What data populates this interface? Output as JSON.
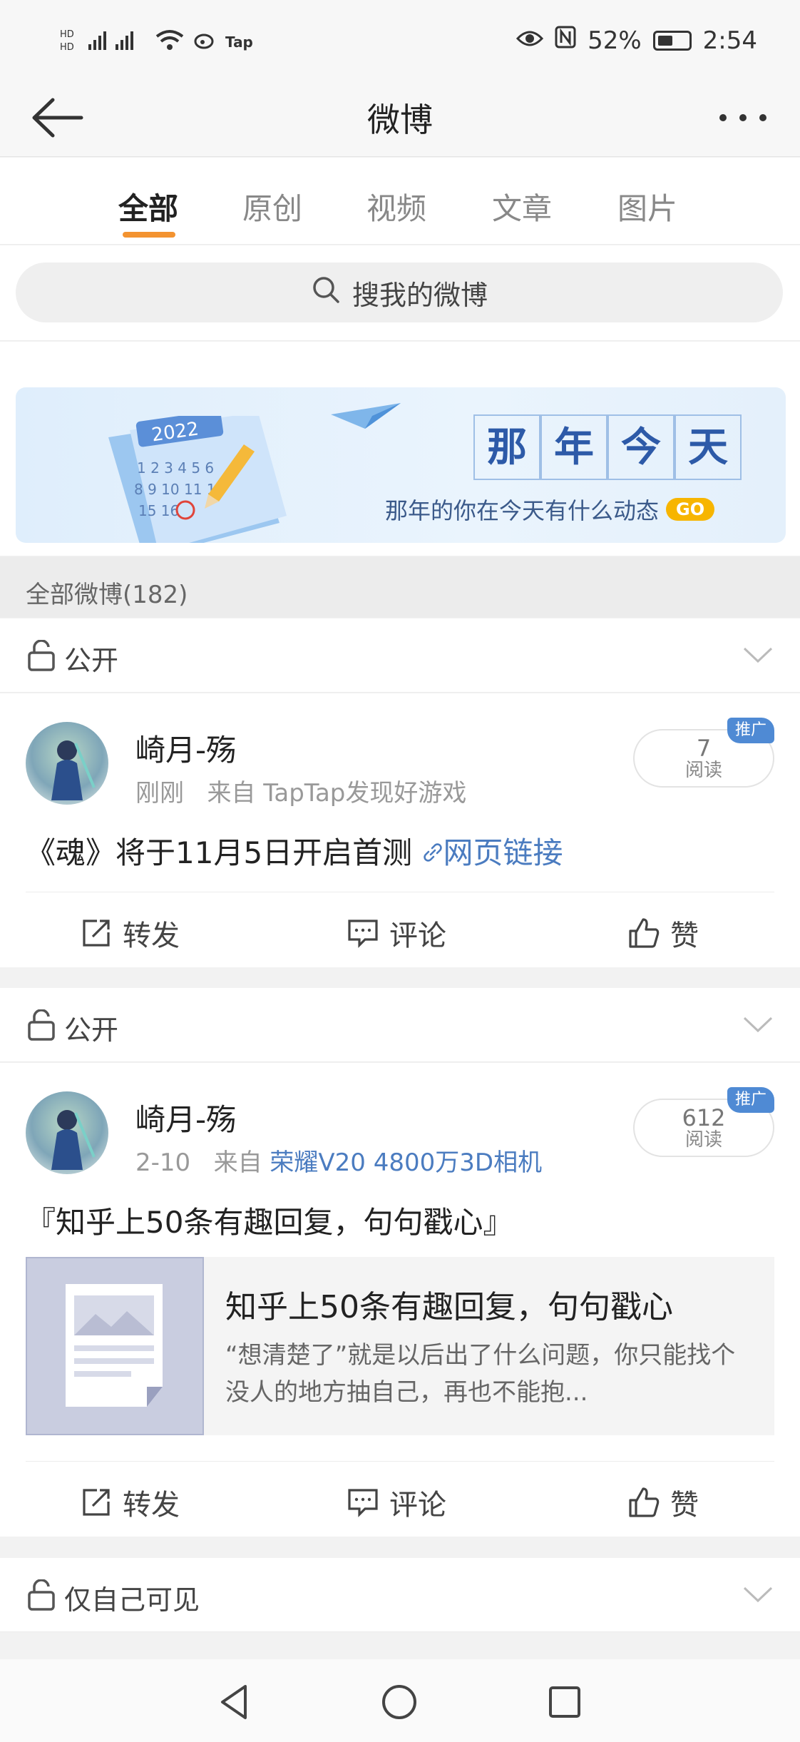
{
  "status_bar": {
    "network_left": "HD 5G 4G",
    "app_hint": "Tap",
    "battery": "52%",
    "time": "2:54"
  },
  "header": {
    "title": "微博"
  },
  "tabs": [
    {
      "label": "全部",
      "active": true
    },
    {
      "label": "原创",
      "active": false
    },
    {
      "label": "视频",
      "active": false
    },
    {
      "label": "文章",
      "active": false
    },
    {
      "label": "图片",
      "active": false
    }
  ],
  "search": {
    "placeholder": "搜我的微博"
  },
  "banner": {
    "title_chars": [
      "那",
      "年",
      "今",
      "天"
    ],
    "subtitle": "那年的你在今天有什么动态",
    "go_label": "GO",
    "calendar_year": "2022"
  },
  "count_label": "全部微博(182)",
  "posts": [
    {
      "visibility": "公开",
      "user": "崎月-殇",
      "time": "刚刚",
      "source_prefix": "来自",
      "source": "TapTap发现好游戏",
      "reads": "7",
      "reads_label": "阅读",
      "promo": "推广",
      "text": "《魂》将于11月5日开启首测",
      "link_label": "网页链接",
      "actions": {
        "repost": "转发",
        "comment": "评论",
        "like": "赞"
      }
    },
    {
      "visibility": "公开",
      "user": "崎月-殇",
      "time": "2-10",
      "source_prefix": "来自",
      "source": "荣耀V20 4800万3D相机",
      "reads": "612",
      "reads_label": "阅读",
      "promo": "推广",
      "text": "『知乎上50条有趣回复，句句戳心』",
      "article_title": "知乎上50条有趣回复，句句戳心",
      "article_desc": "“想清楚了”就是以后出了什么问题，你只能找个没人的地方抽自己，再也不能抱...",
      "actions": {
        "repost": "转发",
        "comment": "评论",
        "like": "赞"
      }
    }
  ],
  "third_visibility": "仅自己可见",
  "colors": {
    "accent": "#f39330",
    "link": "#4b7cc0",
    "promo": "#4f8ad4"
  }
}
